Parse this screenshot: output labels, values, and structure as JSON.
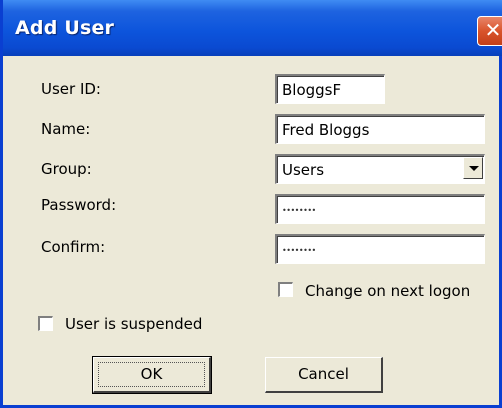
{
  "window": {
    "title": "Add User",
    "close_symbol": "✕"
  },
  "form": {
    "user_id": {
      "label": "User ID:",
      "value": "BloggsF"
    },
    "name": {
      "label": "Name:",
      "value": "Fred Bloggs"
    },
    "group": {
      "label": "Group:",
      "value": "Users"
    },
    "password": {
      "label": "Password:",
      "value": "••••••••"
    },
    "confirm": {
      "label": "Confirm:",
      "value": "••••••••"
    },
    "change_on_next_logon": {
      "label": "Change on next logon",
      "checked": false
    },
    "user_is_suspended": {
      "label": "User is suspended",
      "checked": false
    }
  },
  "buttons": {
    "ok": "OK",
    "cancel": "Cancel"
  },
  "icons": {
    "close": "close-icon",
    "dropdown": "chevron-down-icon"
  }
}
